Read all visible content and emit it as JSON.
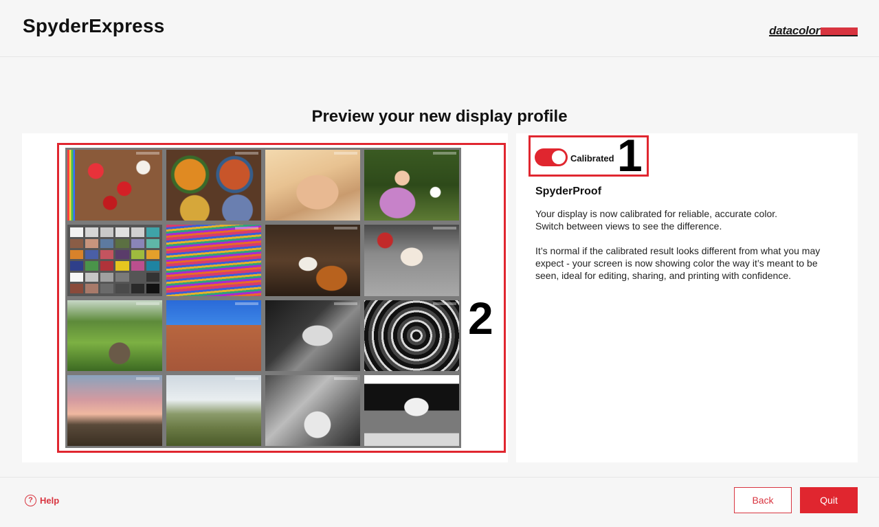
{
  "app": {
    "title": "SpyderExpress",
    "brand": "datacolor"
  },
  "main": {
    "heading": "Preview your new display profile"
  },
  "callouts": {
    "one": "1",
    "two": "2"
  },
  "toggle": {
    "label": "Calibrated",
    "on": true
  },
  "info": {
    "title": "SpyderProof",
    "line1": "Your display is now calibrated for reliable, accurate color.",
    "line2": "Switch between views to see the difference.",
    "paragraph": "It’s normal if the calibrated result looks different from what you may expect - your screen is now showing color the way it’s meant to be seen, ideal for editing, sharing, and printing with confidence."
  },
  "footer": {
    "help_label": "Help",
    "help_icon": "?",
    "back_label": "Back",
    "quit_label": "Quit"
  },
  "colors": {
    "accent": "#e0262f",
    "brand_bar": "#d8343f"
  },
  "preview_images": [
    "peppers",
    "painted-plates",
    "woman-face",
    "girl-with-flowers",
    "colorchecker-chart",
    "striped-fabric",
    "cellist",
    "marilyn-window",
    "garden-urn",
    "adobe-church",
    "bw-portrait",
    "spiral-staircase",
    "pink-sunset-hills",
    "tuscany-landscape",
    "bw-scooter",
    "grayscale-test-chart"
  ]
}
